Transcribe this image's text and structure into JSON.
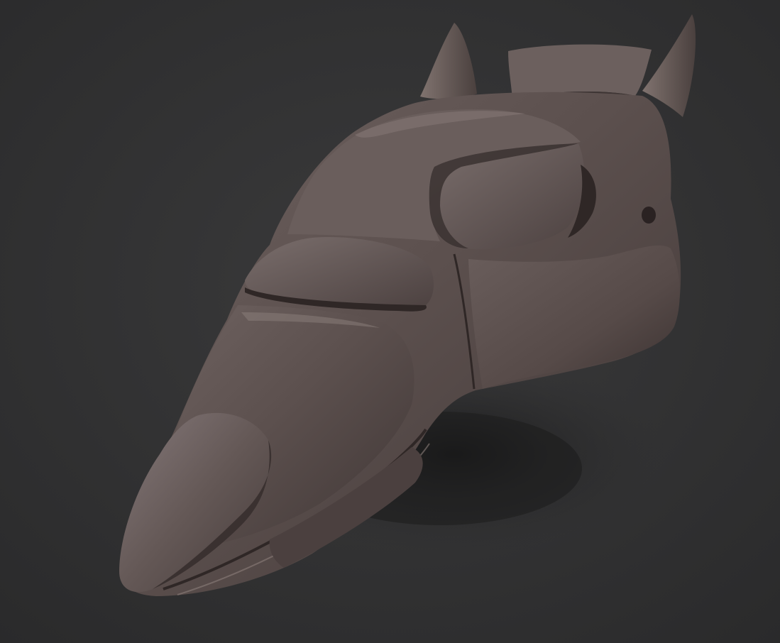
{
  "scene": {
    "subject": "sculpted-creature-head",
    "material": "clay-matcap",
    "colors": {
      "background": "#2e2e2f",
      "background_center": "#3a3a3b",
      "clay_light": "#7b6d6b",
      "clay_mid": "#5e5250",
      "clay_dark": "#3e3534",
      "edge_highlight": "#8c7f7c",
      "groove_shadow": "#2f2726",
      "cast_shadow": "#1e1e1f"
    }
  }
}
